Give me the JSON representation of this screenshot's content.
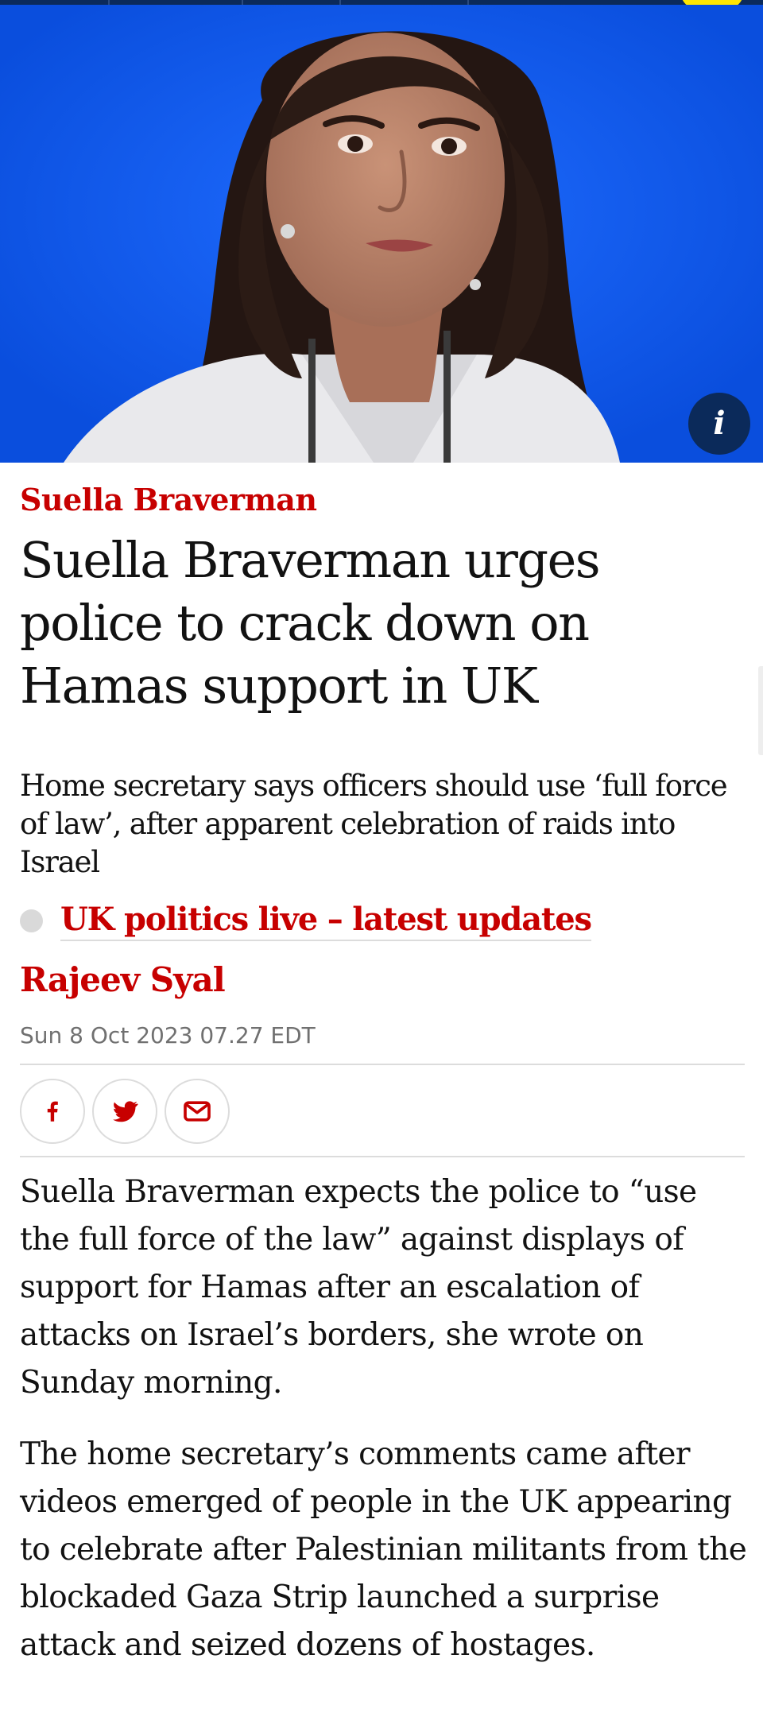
{
  "header": {
    "accent_color": "#ffe500",
    "nav_color": "#0b2a5a"
  },
  "hero": {
    "background_color": "#0d5cf1",
    "info_icon_glyph": "i"
  },
  "article": {
    "kicker": "Suella Braverman",
    "headline": "Suella Braverman urges police to crack down on Hamas support in UK",
    "standfirst": "Home secretary says officers should use ‘full force of law’, after apparent celebration of raids into Israel",
    "live_link": "UK politics live – latest updates",
    "byline": "Rajeev Syal",
    "dateline": "Sun 8 Oct 2023 07.27 EDT",
    "share": {
      "facebook_icon": "facebook-icon",
      "twitter_icon": "twitter-icon",
      "email_icon": "email-icon"
    },
    "body": [
      "Suella Braverman expects the police to “use the full force of the law” against displays of support for Hamas after an escalation of attacks on Israel’s borders, she wrote on Sunday morning.",
      "The home secretary’s comments came after videos emerged of people in the UK appearing to celebrate after Palestinian militants from the blockaded Gaza Strip launched a surprise attack and seized dozens of hostages."
    ],
    "kicker_color": "#c70000",
    "text_color": "#121212"
  }
}
